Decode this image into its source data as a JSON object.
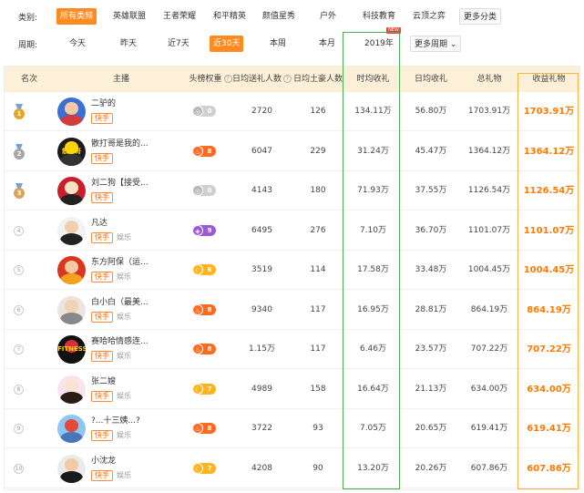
{
  "filters": {
    "category": {
      "label": "类别:",
      "items": [
        {
          "label": "所有类频",
          "active": true
        },
        {
          "label": "英雄联盟",
          "active": false
        },
        {
          "label": "王者荣耀",
          "active": false
        },
        {
          "label": "和平精英",
          "active": false
        },
        {
          "label": "颜值星秀",
          "active": false
        },
        {
          "label": "户外",
          "active": false
        },
        {
          "label": "科技教育",
          "active": false
        },
        {
          "label": "云顶之弈",
          "active": false
        }
      ],
      "more_label": "更多分类"
    },
    "period": {
      "label": "周期:",
      "items": [
        {
          "label": "今天",
          "active": false
        },
        {
          "label": "昨天",
          "active": false
        },
        {
          "label": "近7天",
          "active": false
        },
        {
          "label": "近30天",
          "active": true
        },
        {
          "label": "本周",
          "active": false
        },
        {
          "label": "本月",
          "active": false
        },
        {
          "label": "2019年",
          "active": false,
          "badge": "NEW"
        }
      ],
      "more_label": "更多周期 ⌄"
    }
  },
  "table": {
    "columns": [
      "名次",
      "主播",
      "头榜权重",
      "日均送礼人数",
      "日均土豪人数",
      "时均收礼",
      "日均收礼",
      "总礼物",
      "收益礼物"
    ],
    "colors": {
      "gold": "#e4a52a",
      "silver": "#a6a6a6",
      "bronze": "#d8a45a",
      "accent": "#ff7a00",
      "highlight_green": "#4bb34b",
      "highlight_orange": "#f0b44a"
    },
    "rows": [
      {
        "rank": "1",
        "medal": "gold",
        "name": "二驴的",
        "platform": "快手",
        "category": "",
        "weight_icon": "gray",
        "weight": "0",
        "givers": "2720",
        "rich": "126",
        "hourly": "134.11万",
        "daily": "56.80万",
        "total": "1703.91万",
        "income": "1703.91万"
      },
      {
        "rank": "2",
        "medal": "silver",
        "name": "散打哥是我的...",
        "platform": "快手",
        "category": "",
        "weight_icon": "fire",
        "weight": "8",
        "givers": "6047",
        "rich": "229",
        "hourly": "31.24万",
        "daily": "45.47万",
        "total": "1364.12万",
        "income": "1364.12万",
        "avatar_text": "散打哥"
      },
      {
        "rank": "3",
        "medal": "bronze",
        "name": "刘二狗【接受...",
        "platform": "快手",
        "category": "",
        "weight_icon": "gray",
        "weight": "0",
        "givers": "4143",
        "rich": "180",
        "hourly": "71.93万",
        "daily": "37.55万",
        "total": "1126.54万",
        "income": "1126.54万"
      },
      {
        "rank": "4",
        "medal": "",
        "name": "凡达",
        "platform": "快手",
        "category": "娱乐",
        "weight_icon": "purple",
        "weight": "9",
        "givers": "6495",
        "rich": "276",
        "hourly": "7.10万",
        "daily": "36.70万",
        "total": "1101.07万",
        "income": "1101.07万"
      },
      {
        "rank": "5",
        "medal": "",
        "name": "东方阿保（运...",
        "platform": "快手",
        "category": "娱乐",
        "weight_icon": "moon",
        "weight": "6",
        "givers": "3519",
        "rich": "114",
        "hourly": "17.58万",
        "daily": "33.48万",
        "total": "1004.45万",
        "income": "1004.45万"
      },
      {
        "rank": "6",
        "medal": "",
        "name": "白小白（最美...",
        "platform": "快手",
        "category": "娱乐",
        "weight_icon": "fire",
        "weight": "8",
        "givers": "9340",
        "rich": "117",
        "hourly": "16.95万",
        "daily": "28.81万",
        "total": "864.19万",
        "income": "864.19万"
      },
      {
        "rank": "7",
        "medal": "",
        "name": "赛哈哈情感连...",
        "platform": "快手",
        "category": "娱乐",
        "weight_icon": "fire",
        "weight": "8",
        "givers": "1.15万",
        "rich": "117",
        "hourly": "6.46万",
        "daily": "23.57万",
        "total": "707.22万",
        "income": "707.22万",
        "avatar_text": "FITNESS"
      },
      {
        "rank": "8",
        "medal": "",
        "name": "张二嫂",
        "platform": "快手",
        "category": "娱乐",
        "weight_icon": "moon",
        "weight": "7",
        "givers": "4989",
        "rich": "158",
        "hourly": "16.64万",
        "daily": "21.13万",
        "total": "634.00万",
        "income": "634.00万"
      },
      {
        "rank": "9",
        "medal": "",
        "name": "?...十三姨...?",
        "platform": "快手",
        "category": "娱乐",
        "weight_icon": "fire",
        "weight": "8",
        "givers": "3722",
        "rich": "93",
        "hourly": "7.05万",
        "daily": "20.65万",
        "total": "619.41万",
        "income": "619.41万"
      },
      {
        "rank": "10",
        "medal": "",
        "name": "小沈龙",
        "platform": "快手",
        "category": "娱乐",
        "weight_icon": "moon",
        "weight": "7",
        "givers": "4208",
        "rich": "90",
        "hourly": "13.20万",
        "daily": "20.26万",
        "total": "607.86万",
        "income": "607.86万"
      }
    ]
  }
}
